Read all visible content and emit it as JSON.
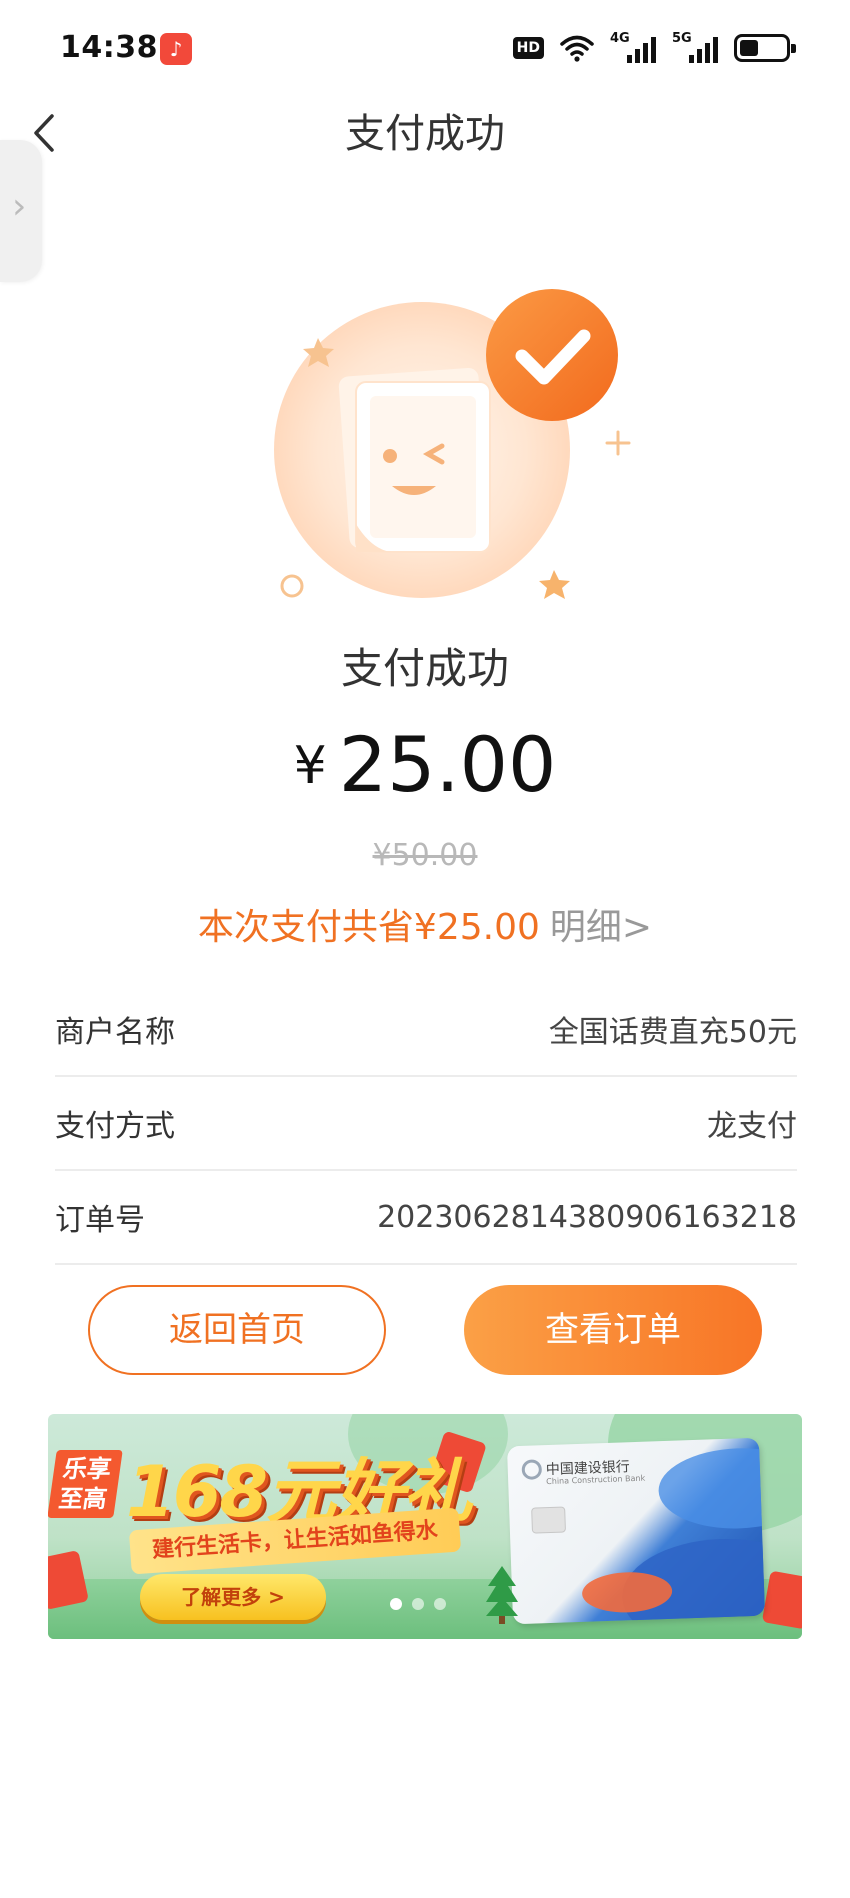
{
  "status_bar": {
    "time": "14:38",
    "hd_label": "HD",
    "net1_label": "4G",
    "net2_label": "5G"
  },
  "header": {
    "title": "支付成功"
  },
  "result": {
    "status_text": "支付成功",
    "currency_symbol": "¥",
    "amount": "25.00",
    "original_price": "¥50.00",
    "savings_text": "本次支付共省¥25.00",
    "detail_link": "明细>"
  },
  "details": [
    {
      "label": "商户名称",
      "value": "全国话费直充50元"
    },
    {
      "label": "支付方式",
      "value": "龙支付"
    },
    {
      "label": "订单号",
      "value": "202306281438090616321 8"
    }
  ],
  "buttons": {
    "home_label": "返回首页",
    "order_label": "查看订单"
  },
  "banner": {
    "tag": "乐享至高",
    "headline": "168元好礼",
    "subline": "建行生活卡，让生活如鱼得水",
    "cta": "了解更多 >",
    "bank_name": "中国建设银行",
    "bank_name_en": "China Construction Bank",
    "page_count": 3,
    "active_page": 1
  },
  "colors": {
    "accent": "#f07122",
    "button_gradient_start": "#fba046",
    "button_gradient_end": "#f87526"
  }
}
